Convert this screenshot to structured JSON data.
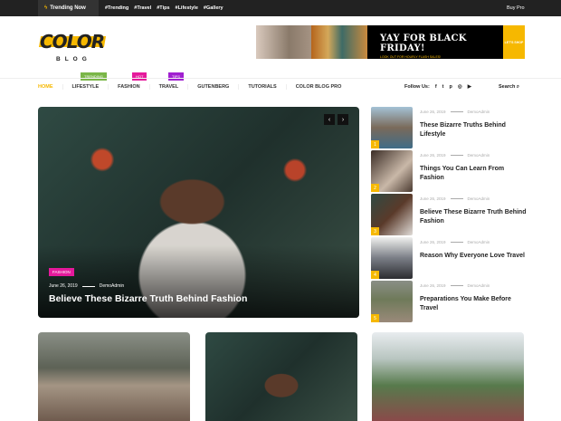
{
  "topbar": {
    "trending": "Trending Now",
    "tags": [
      "#Trending",
      "#Travel",
      "#Tips",
      "#Lifestyle",
      "#Gallery"
    ],
    "buy_pro": "Buy Pro"
  },
  "logo": {
    "word": "COLOR",
    "sub": "BLOG"
  },
  "banner": {
    "headline": "YAY FOR BLACK FRIDAY!",
    "sub": "LOOK OUT FOR HOURLY FLASH SALES!",
    "cta": "LET'S SHOP"
  },
  "badges": {
    "trending": "TRENDING",
    "hot": "HOT",
    "tips": "TIPS"
  },
  "nav": [
    "HOME",
    "LIFESTYLE",
    "FASHION",
    "TRAVEL",
    "GUTENBERG",
    "TUTORIALS",
    "COLOR BLOG PRO"
  ],
  "follow": "Follow Us:",
  "search": "Search",
  "hero": {
    "category": "FASHION",
    "date": "June 26, 2019",
    "author": "DemoAdmin",
    "title": "Believe These Bizarre Truth Behind Fashion"
  },
  "sidebar": [
    {
      "n": "1",
      "date": "June 26, 2019",
      "author": "DemoAdmin",
      "title": "These Bizarre Truths Behind Lifestyle"
    },
    {
      "n": "2",
      "date": "June 26, 2019",
      "author": "DemoAdmin",
      "title": "Things You Can Learn From Fashion"
    },
    {
      "n": "3",
      "date": "June 26, 2019",
      "author": "DemoAdmin",
      "title": "Believe These Bizarre Truth Behind Fashion"
    },
    {
      "n": "4",
      "date": "June 26, 2019",
      "author": "DemoAdmin",
      "title": "Reason Why Everyone Love Travel"
    },
    {
      "n": "5",
      "date": "June 26, 2019",
      "author": "DemoAdmin",
      "title": "Preparations You Make Before Travel"
    }
  ],
  "colors": {
    "accent": "#f6b800",
    "trending": "#7ab648",
    "hot": "#e5199b",
    "tips": "#a020d0"
  }
}
